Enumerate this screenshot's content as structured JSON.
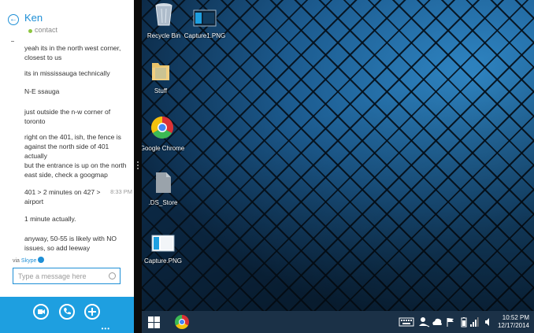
{
  "chat": {
    "contact_name": "Ken",
    "contact_status": "contact",
    "messages": [
      {
        "text": "yeah its in the north west corner, closest to us",
        "time": ""
      },
      {
        "text": "its in mississauga technically",
        "time": ""
      },
      {
        "text": "N-E ssauga",
        "time": ""
      },
      {
        "text": "just outside the n-w corner of toronto",
        "time": ""
      },
      {
        "text": "right on the 401, ish, the fence is against the north side of 401 actually",
        "time": ""
      },
      {
        "text": "but the entrance is up on the north east side, check a googmap",
        "time": ""
      },
      {
        "text": "401 > 2 minutes on 427 > airport",
        "time": "8:33 PM"
      },
      {
        "text": "1 minute actually.",
        "time": ""
      },
      {
        "text": "anyway, 50-55 is likely with NO issues, so add leeway",
        "time": ""
      }
    ],
    "via_label": "via",
    "via_service": "Skype",
    "input_placeholder": "Type a message here",
    "buttons": [
      "video-call",
      "voice-call",
      "add"
    ],
    "more": "•••"
  },
  "desktop": {
    "icons": [
      {
        "label": "Recycle Bin",
        "icon": "recycle-bin-icon"
      },
      {
        "label": "Capture1.PNG",
        "icon": "image-file-icon"
      },
      {
        "label": "Stuff",
        "icon": "folder-icon"
      },
      {
        "label": "Google Chrome",
        "icon": "chrome-icon"
      },
      {
        "label": ".DS_Store",
        "icon": "file-icon"
      },
      {
        "label": "Capture.PNG",
        "icon": "image-file-icon"
      }
    ]
  },
  "taskbar": {
    "pinned": [
      "windows-start-icon",
      "chrome-icon"
    ],
    "tray_icons": [
      "keyboard-icon",
      "people-icon",
      "cloud-icon",
      "flag-icon",
      "battery-icon",
      "signal-icon",
      "volume-icon"
    ],
    "time": "10:52 PM",
    "date": "12/17/2014"
  },
  "colors": {
    "accent": "#1e9fe0",
    "taskbar": "#1b3147",
    "online": "#8dc63f"
  }
}
